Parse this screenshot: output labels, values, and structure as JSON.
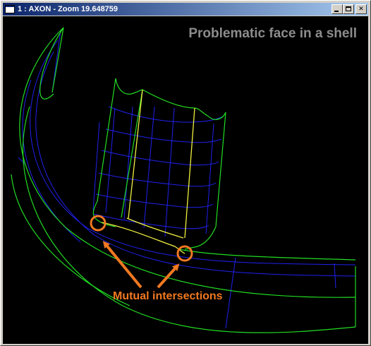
{
  "window": {
    "title": "1 : AXON - Zoom 19.648759",
    "buttons": {
      "minimize": "minimize-icon",
      "maximize": "maximize-icon",
      "close": "close-icon",
      "close_glyph": "✕"
    }
  },
  "viewport": {
    "heading": "Problematic face in a shell",
    "callout": "Mutual intersections"
  },
  "colors": {
    "background": "#000000",
    "edges": "#22dd22",
    "isolines": "#2020ee",
    "highlighted_face": "#f0f040",
    "callout": "#f07820",
    "heading": "#8c8c8c"
  }
}
